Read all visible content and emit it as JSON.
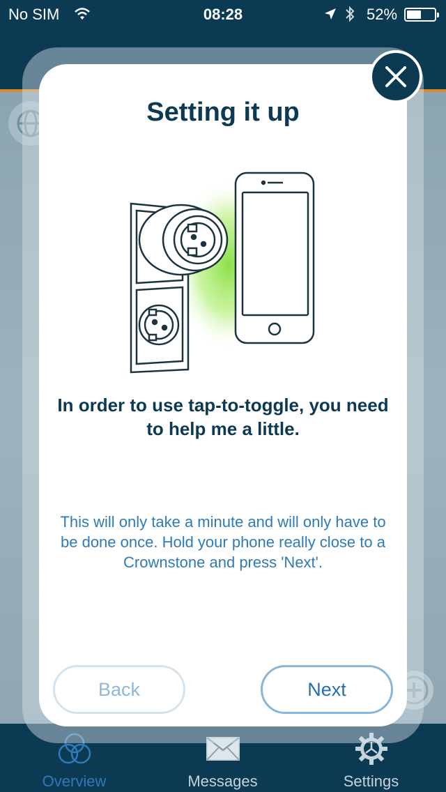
{
  "status_bar": {
    "carrier": "No SIM",
    "time": "08:28",
    "battery": "52%",
    "battery_level": 0.52
  },
  "modal": {
    "title": "Setting it up",
    "headline": "In order to use tap-to-toggle, you need to help me a little.",
    "body": "This will only take a minute and will only have to be done once. Hold your phone really close to a Crownstone and press 'Next'.",
    "back_label": "Back",
    "next_label": "Next",
    "close_icon": "close-icon",
    "illustration_icons": [
      "power-socket-icon",
      "smartphone-icon"
    ]
  },
  "tab_bar": {
    "tabs": [
      {
        "label": "Overview",
        "icon": "overview-icon",
        "active": true
      },
      {
        "label": "Messages",
        "icon": "envelope-icon",
        "active": false
      },
      {
        "label": "Settings",
        "icon": "gear-icon",
        "active": false
      }
    ]
  },
  "colors": {
    "navy": "#0c3a52",
    "accent_orange": "#d98a2b",
    "blue_text": "#2f7ab9",
    "glow_green": "#8be04a"
  }
}
